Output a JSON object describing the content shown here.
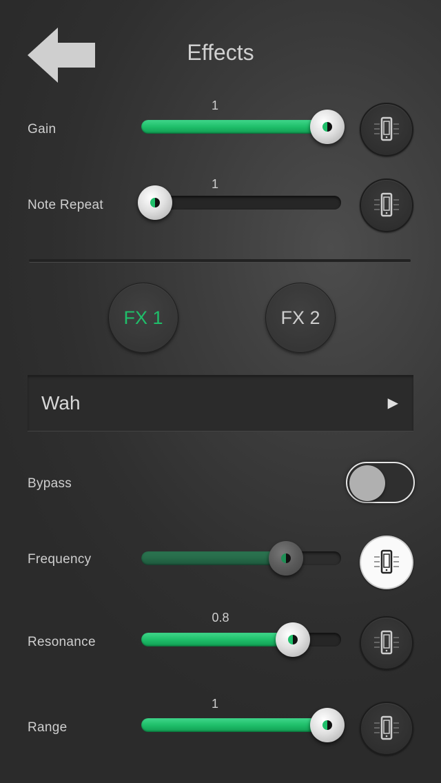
{
  "header": {
    "title": "Effects"
  },
  "colors": {
    "accent": "#1fbf6a",
    "text": "#cfcfcf"
  },
  "icons": {
    "back": "back-arrow-icon",
    "phone": "phone-tilt-icon"
  },
  "top_sliders": [
    {
      "label": "Gain",
      "value_text": "1",
      "value": 1.0
    },
    {
      "label": "Note Repeat",
      "value_text": "1",
      "value": 0.0
    }
  ],
  "fx_buttons": [
    {
      "label": "FX 1",
      "selected": true
    },
    {
      "label": "FX 2",
      "selected": false
    }
  ],
  "effect_select": {
    "selected": "Wah"
  },
  "bypass": {
    "label": "Bypass",
    "on": false
  },
  "effect_sliders": [
    {
      "label": "Frequency",
      "value_text": "",
      "value": 0.72,
      "phone_active": true
    },
    {
      "label": "Resonance",
      "value_text": "0.8",
      "value": 0.76,
      "phone_active": false
    },
    {
      "label": "Range",
      "value_text": "1",
      "value": 1.0,
      "phone_active": false
    }
  ]
}
